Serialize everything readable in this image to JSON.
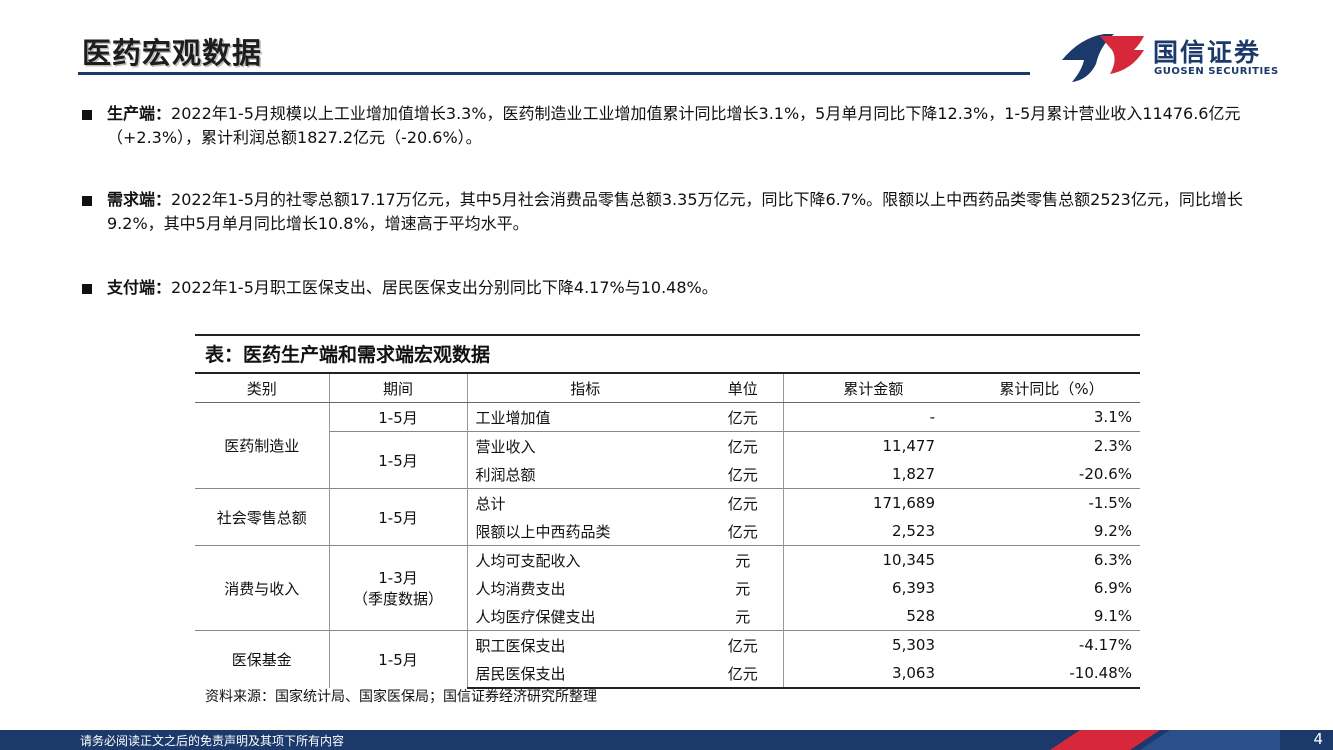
{
  "header": {
    "title": "医药宏观数据"
  },
  "logo": {
    "name_cn": "国信证券",
    "name_en": "GUOSEN SECURITIES"
  },
  "bullets": [
    {
      "key": "生产端",
      "sep": "：",
      "text": "2022年1-5月规模以上工业增加值增长3.3%，医药制造业工业增加值累计同比增长3.1%，5月单月同比下降12.3%，1-5月累计营业收入11476.6亿元（+2.3%），累计利润总额1827.2亿元（-20.6%）。"
    },
    {
      "key": "需求端",
      "sep": "：",
      "text": "2022年1-5月的社零总额17.17万亿元，其中5月社会消费品零售总额3.35万亿元，同比下降6.7%。限额以上中西药品类零售总额2523亿元，同比增长9.2%，其中5月单月同比增长10.8%，增速高于平均水平。"
    },
    {
      "key": "支付端",
      "sep": "：",
      "text": "2022年1-5月职工医保支出、居民医保支出分别同比下降4.17%与10.48%。"
    }
  ],
  "table": {
    "title": "表：医药生产端和需求端宏观数据",
    "headers": [
      "类别",
      "期间",
      "指标",
      "单位",
      "累计金额",
      "累计同比（%）"
    ],
    "groups": [
      {
        "category": "医药制造业",
        "period_a": "1-5月",
        "period_b": "1-5月",
        "rows": [
          {
            "indicator": "工业增加值",
            "unit": "亿元",
            "amount": "-",
            "yoy": "3.1%"
          },
          {
            "indicator": "营业收入",
            "unit": "亿元",
            "amount": "11,477",
            "yoy": "2.3%"
          },
          {
            "indicator": "利润总额",
            "unit": "亿元",
            "amount": "1,827",
            "yoy": "-20.6%"
          }
        ]
      },
      {
        "category": "社会零售总额",
        "period": "1-5月",
        "rows": [
          {
            "indicator": "总计",
            "unit": "亿元",
            "amount": "171,689",
            "yoy": "-1.5%"
          },
          {
            "indicator": "限额以上中西药品类",
            "unit": "亿元",
            "amount": "2,523",
            "yoy": "9.2%"
          }
        ]
      },
      {
        "category": "消费与收入",
        "period": "1-3月",
        "period_note": "（季度数据）",
        "rows": [
          {
            "indicator": "人均可支配收入",
            "unit": "元",
            "amount": "10,345",
            "yoy": "6.3%"
          },
          {
            "indicator": "人均消费支出",
            "unit": "元",
            "amount": "6,393",
            "yoy": "6.9%"
          },
          {
            "indicator": "人均医疗保健支出",
            "unit": "元",
            "amount": "528",
            "yoy": "9.1%"
          }
        ]
      },
      {
        "category": "医保基金",
        "period": "1-5月",
        "rows": [
          {
            "indicator": "职工医保支出",
            "unit": "亿元",
            "amount": "5,303",
            "yoy": "-4.17%"
          },
          {
            "indicator": "居民医保支出",
            "unit": "亿元",
            "amount": "3,063",
            "yoy": "-10.48%"
          }
        ]
      }
    ],
    "source": "资料来源：国家统计局、国家医保局；国信证券经济研究所整理"
  },
  "footer": {
    "disclaimer": "请务必阅读正文之后的免责声明及其项下所有内容",
    "page": "4"
  },
  "colors": {
    "navy": "#1b3a6b",
    "red": "#d7283b"
  }
}
